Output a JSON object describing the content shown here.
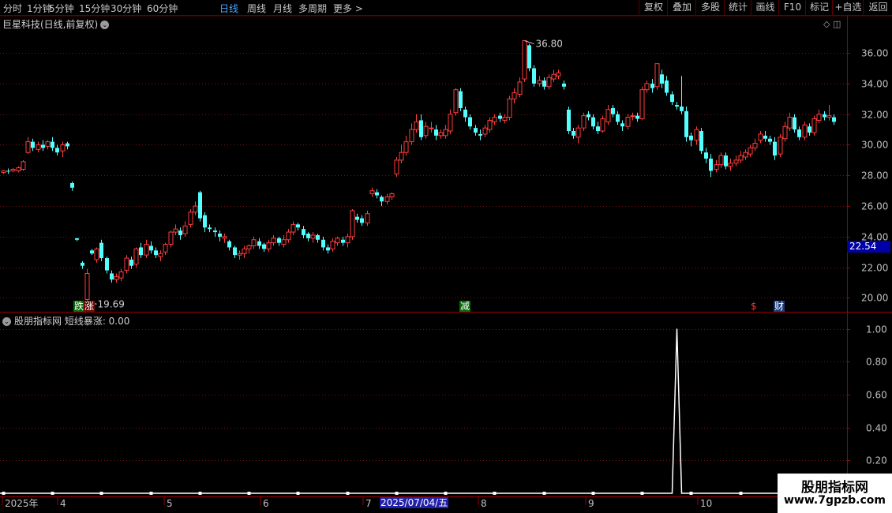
{
  "toolbar": {
    "periods": [
      "分时",
      "1分钟",
      "5分钟",
      "15分钟",
      "30分钟",
      "60分钟",
      "日线",
      "周线",
      "月线",
      "多周期",
      "更多 >"
    ],
    "active_period": "日线",
    "buttons": [
      "复权",
      "叠加",
      "多股",
      "统计",
      "画线",
      "F10",
      "标记",
      "+自选",
      "返回"
    ]
  },
  "main_panel": {
    "title": "巨星科技(日线,前复权)",
    "window_controls": "◇ ◫",
    "current_price": "22.54",
    "high_label": "36.80",
    "low_label": "19.69",
    "events": [
      {
        "text": "跌",
        "color": "#ffffff",
        "bg": "#0a6a0a"
      },
      {
        "text": "涨",
        "color": "#ffffff",
        "bg": "#6a0a0a"
      },
      {
        "text": "减",
        "color": "#ffffff",
        "bg": "#0a6a0a"
      },
      {
        "text": "$",
        "color": "#ff3030",
        "bg": "#000000"
      },
      {
        "text": "财",
        "color": "#ffffff",
        "bg": "#1a3a7a"
      }
    ]
  },
  "indicator_panel": {
    "title": "股朋指标网 短线暴涨: 0.00"
  },
  "x_axis": {
    "labels": [
      "2025年",
      "4",
      "5",
      "6",
      "7",
      "8",
      "9",
      "10"
    ],
    "cursor_date": "2025/07/04/五"
  },
  "watermark": {
    "line1": "股朋指标网",
    "line2": "www.7gpzb.com"
  },
  "colors": {
    "up": "#ff3d3d",
    "down": "#54ffff",
    "grid": "#7a1010",
    "axis_text": "#c0c0c0",
    "signal": "#ffffff"
  },
  "chart_data": [
    {
      "type": "candlestick",
      "title": "巨星科技(日线,前复权)",
      "y_ticks": [
        20,
        22,
        24,
        26,
        28,
        30,
        32,
        34,
        36
      ],
      "ylim": [
        19.2,
        37.5
      ],
      "candles": [
        [
          28.2,
          28.3,
          28.1,
          28.35
        ],
        [
          28.3,
          28.25,
          28.1,
          28.45
        ],
        [
          28.3,
          28.4,
          28.2,
          28.5
        ],
        [
          28.3,
          28.5,
          28.2,
          28.6
        ],
        [
          28.4,
          28.9,
          28.3,
          29.0
        ],
        [
          29.5,
          30.2,
          29.4,
          30.5
        ],
        [
          30.2,
          29.8,
          29.6,
          30.4
        ],
        [
          29.7,
          30.0,
          29.5,
          30.2
        ],
        [
          30.0,
          29.8,
          29.6,
          30.3
        ],
        [
          29.9,
          30.2,
          29.7,
          30.3
        ],
        [
          30.2,
          29.8,
          29.6,
          30.5
        ],
        [
          29.8,
          29.5,
          29.3,
          30.0
        ],
        [
          29.6,
          30.0,
          29.2,
          30.2
        ],
        [
          30.1,
          29.9,
          29.7,
          30.2
        ],
        [
          27.5,
          27.2,
          27.0,
          27.6
        ],
        [
          23.9,
          23.8,
          23.7,
          23.9
        ],
        [
          22.3,
          22.1,
          21.9,
          22.4
        ],
        [
          19.9,
          21.6,
          19.7,
          21.9
        ],
        [
          23.1,
          22.9,
          22.8,
          23.2
        ],
        [
          22.5,
          23.2,
          22.3,
          23.3
        ],
        [
          23.6,
          22.6,
          22.4,
          23.8
        ],
        [
          22.6,
          21.8,
          21.6,
          22.7
        ],
        [
          21.6,
          21.2,
          21.0,
          21.8
        ],
        [
          21.2,
          21.4,
          21.0,
          21.6
        ],
        [
          21.3,
          21.7,
          21.1,
          21.9
        ],
        [
          21.8,
          22.6,
          21.6,
          22.8
        ],
        [
          22.5,
          22.1,
          21.9,
          22.7
        ],
        [
          22.2,
          23.2,
          22.0,
          23.3
        ],
        [
          23.3,
          22.8,
          22.6,
          23.6
        ],
        [
          22.8,
          23.5,
          22.6,
          23.8
        ],
        [
          23.4,
          23.1,
          22.9,
          23.7
        ],
        [
          23.1,
          22.8,
          22.6,
          23.3
        ],
        [
          22.7,
          22.9,
          22.4,
          23.1
        ],
        [
          23.0,
          23.5,
          22.8,
          23.6
        ],
        [
          23.5,
          24.3,
          23.3,
          24.4
        ],
        [
          24.3,
          24.5,
          24.1,
          24.8
        ],
        [
          24.4,
          24.1,
          23.8,
          24.6
        ],
        [
          24.2,
          24.7,
          24.0,
          25.0
        ],
        [
          24.8,
          25.6,
          24.6,
          25.8
        ],
        [
          25.6,
          26.0,
          25.4,
          26.3
        ],
        [
          26.9,
          25.2,
          25.0,
          27.0
        ],
        [
          25.4,
          24.6,
          24.3,
          25.6
        ],
        [
          24.6,
          24.5,
          24.3,
          24.8
        ],
        [
          24.4,
          24.3,
          24.0,
          24.6
        ],
        [
          24.2,
          24.0,
          23.7,
          24.4
        ],
        [
          23.9,
          24.0,
          23.6,
          24.2
        ],
        [
          23.7,
          23.3,
          23.1,
          23.8
        ],
        [
          23.3,
          22.8,
          22.6,
          23.4
        ],
        [
          22.8,
          22.9,
          22.5,
          23.1
        ],
        [
          22.9,
          23.2,
          22.6,
          23.4
        ],
        [
          23.2,
          23.4,
          22.9,
          23.5
        ],
        [
          23.4,
          23.8,
          23.2,
          24.0
        ],
        [
          23.7,
          23.4,
          23.2,
          23.9
        ],
        [
          23.5,
          23.2,
          23.0,
          23.6
        ],
        [
          23.2,
          23.6,
          23.0,
          23.8
        ],
        [
          23.6,
          23.9,
          23.4,
          24.1
        ],
        [
          23.9,
          23.6,
          23.4,
          24.0
        ],
        [
          23.5,
          23.8,
          23.3,
          24.1
        ],
        [
          23.8,
          24.3,
          23.6,
          24.5
        ],
        [
          24.3,
          24.8,
          24.1,
          25.0
        ],
        [
          24.8,
          24.6,
          24.4,
          24.9
        ],
        [
          24.5,
          24.1,
          23.9,
          24.7
        ],
        [
          24.2,
          23.9,
          23.7,
          24.3
        ],
        [
          23.9,
          24.1,
          23.6,
          24.3
        ],
        [
          24.1,
          23.8,
          23.6,
          24.2
        ],
        [
          23.8,
          23.3,
          23.1,
          24.0
        ],
        [
          23.3,
          23.1,
          22.9,
          23.5
        ],
        [
          23.2,
          23.7,
          23.0,
          23.9
        ],
        [
          23.6,
          23.9,
          23.4,
          24.0
        ],
        [
          23.8,
          23.6,
          23.4,
          24.0
        ],
        [
          23.6,
          24.0,
          23.3,
          24.2
        ],
        [
          24.0,
          25.7,
          23.8,
          25.8
        ],
        [
          25.3,
          25.1,
          24.9,
          25.5
        ],
        [
          25.2,
          24.9,
          24.7,
          25.4
        ],
        [
          24.9,
          25.5,
          24.7,
          25.7
        ],
        [
          26.8,
          27.0,
          26.6,
          27.2
        ],
        [
          26.9,
          26.7,
          26.5,
          27.1
        ],
        [
          26.6,
          26.3,
          26.0,
          26.7
        ],
        [
          26.3,
          26.6,
          26.1,
          26.8
        ],
        [
          26.6,
          26.8,
          26.4,
          26.9
        ],
        [
          28.1,
          29.0,
          27.9,
          29.2
        ],
        [
          29.0,
          29.5,
          28.8,
          30.0
        ],
        [
          29.5,
          30.2,
          29.3,
          30.6
        ],
        [
          30.2,
          31.0,
          30.0,
          31.4
        ],
        [
          31.0,
          31.5,
          30.8,
          32.0
        ],
        [
          31.6,
          30.5,
          30.3,
          32.0
        ],
        [
          30.6,
          31.2,
          30.4,
          31.5
        ],
        [
          31.1,
          31.1,
          30.8,
          31.5
        ],
        [
          31.0,
          30.6,
          30.3,
          31.3
        ],
        [
          30.6,
          30.8,
          30.4,
          31.0
        ],
        [
          30.6,
          31.0,
          30.4,
          31.3
        ],
        [
          30.9,
          32.0,
          30.7,
          32.3
        ],
        [
          32.1,
          33.6,
          31.9,
          33.7
        ],
        [
          33.5,
          32.4,
          32.2,
          33.7
        ],
        [
          32.3,
          31.8,
          31.5,
          32.5
        ],
        [
          31.8,
          31.2,
          31.0,
          32.0
        ],
        [
          31.1,
          30.8,
          30.6,
          31.3
        ],
        [
          30.7,
          30.6,
          30.3,
          31.0
        ],
        [
          30.7,
          31.1,
          30.5,
          31.3
        ],
        [
          31.0,
          31.6,
          30.8,
          31.8
        ],
        [
          31.5,
          31.8,
          31.3,
          32.0
        ],
        [
          31.9,
          31.7,
          31.5,
          32.1
        ],
        [
          31.6,
          31.8,
          31.4,
          32.0
        ],
        [
          31.8,
          33.0,
          31.6,
          33.2
        ],
        [
          33.0,
          33.4,
          32.7,
          33.7
        ],
        [
          33.3,
          34.1,
          33.1,
          34.4
        ],
        [
          34.3,
          36.8,
          34.1,
          36.8
        ],
        [
          36.5,
          35.0,
          34.8,
          36.6
        ],
        [
          35.0,
          34.0,
          33.8,
          35.2
        ],
        [
          34.0,
          34.2,
          33.8,
          34.5
        ],
        [
          34.2,
          33.8,
          33.6,
          34.4
        ],
        [
          33.8,
          34.4,
          33.6,
          34.6
        ],
        [
          34.3,
          34.6,
          34.1,
          34.9
        ],
        [
          34.5,
          34.7,
          34.3,
          34.9
        ],
        [
          34.0,
          33.8,
          33.6,
          34.2
        ],
        [
          32.3,
          30.9,
          30.7,
          32.5
        ],
        [
          30.9,
          30.6,
          30.4,
          31.1
        ],
        [
          30.5,
          31.1,
          30.1,
          31.3
        ],
        [
          31.1,
          31.9,
          30.9,
          32.1
        ],
        [
          32.0,
          31.8,
          31.6,
          32.2
        ],
        [
          31.8,
          31.2,
          31.0,
          32.0
        ],
        [
          31.2,
          30.9,
          30.7,
          31.5
        ],
        [
          30.9,
          31.7,
          30.8,
          31.9
        ],
        [
          31.5,
          32.3,
          31.3,
          32.6
        ],
        [
          32.4,
          32.0,
          31.8,
          32.6
        ],
        [
          32.0,
          31.5,
          31.3,
          32.2
        ],
        [
          31.4,
          31.2,
          30.9,
          31.6
        ],
        [
          31.2,
          31.8,
          31.0,
          32.0
        ],
        [
          31.9,
          31.9,
          31.6,
          32.1
        ],
        [
          31.9,
          31.7,
          31.5,
          32.1
        ],
        [
          31.7,
          33.6,
          31.6,
          33.8
        ],
        [
          33.6,
          34.0,
          33.4,
          34.2
        ],
        [
          34.0,
          33.7,
          33.4,
          34.3
        ],
        [
          33.8,
          35.3,
          33.6,
          35.3
        ],
        [
          34.6,
          34.0,
          33.7,
          34.9
        ],
        [
          34.2,
          33.4,
          33.2,
          34.5
        ],
        [
          33.3,
          32.8,
          32.6,
          33.5
        ],
        [
          32.6,
          32.5,
          32.3,
          32.8
        ],
        [
          32.5,
          32.2,
          32.0,
          34.5
        ],
        [
          32.2,
          30.5,
          30.2,
          32.5
        ],
        [
          30.6,
          30.3,
          29.9,
          30.8
        ],
        [
          30.3,
          31.0,
          30.0,
          31.2
        ],
        [
          30.9,
          29.6,
          29.4,
          31.1
        ],
        [
          29.5,
          29.1,
          28.8,
          29.8
        ],
        [
          29.1,
          28.3,
          27.9,
          29.4
        ],
        [
          28.4,
          28.7,
          28.2,
          29.0
        ],
        [
          28.7,
          29.3,
          28.5,
          29.5
        ],
        [
          29.3,
          28.6,
          28.4,
          29.5
        ],
        [
          28.6,
          28.8,
          28.3,
          29.1
        ],
        [
          28.8,
          29.0,
          28.6,
          29.3
        ],
        [
          29.0,
          29.3,
          28.8,
          29.6
        ],
        [
          29.2,
          29.5,
          29.0,
          29.7
        ],
        [
          29.4,
          29.8,
          29.2,
          30.0
        ],
        [
          29.8,
          30.1,
          29.6,
          30.4
        ],
        [
          30.3,
          30.7,
          30.1,
          30.9
        ],
        [
          30.6,
          30.4,
          30.2,
          30.9
        ],
        [
          30.4,
          30.2,
          30.0,
          30.6
        ],
        [
          30.2,
          29.3,
          29.0,
          30.5
        ],
        [
          29.4,
          30.5,
          29.2,
          30.7
        ],
        [
          30.4,
          31.2,
          30.2,
          31.5
        ],
        [
          31.1,
          31.8,
          30.9,
          32.1
        ],
        [
          31.8,
          31.0,
          30.8,
          32.0
        ],
        [
          31.0,
          30.5,
          30.3,
          31.2
        ],
        [
          30.5,
          31.3,
          30.3,
          31.5
        ],
        [
          31.2,
          30.8,
          30.6,
          31.4
        ],
        [
          30.8,
          31.7,
          30.6,
          31.9
        ],
        [
          31.6,
          32.0,
          31.4,
          32.3
        ],
        [
          32.0,
          31.8,
          31.6,
          32.2
        ],
        [
          31.8,
          31.9,
          31.6,
          32.6
        ],
        [
          31.8,
          31.5,
          31.3,
          32.0
        ]
      ]
    },
    {
      "type": "line",
      "title": "股朋指标网 短线暴涨",
      "y_ticks": [
        0.2,
        0.4,
        0.6,
        0.8,
        1.0
      ],
      "ylim": [
        0,
        1.06
      ],
      "spike_candle_index": 137,
      "spike_value": 1.0,
      "series": [
        {
          "name": "短线暴涨",
          "baseline": 0
        }
      ]
    }
  ]
}
